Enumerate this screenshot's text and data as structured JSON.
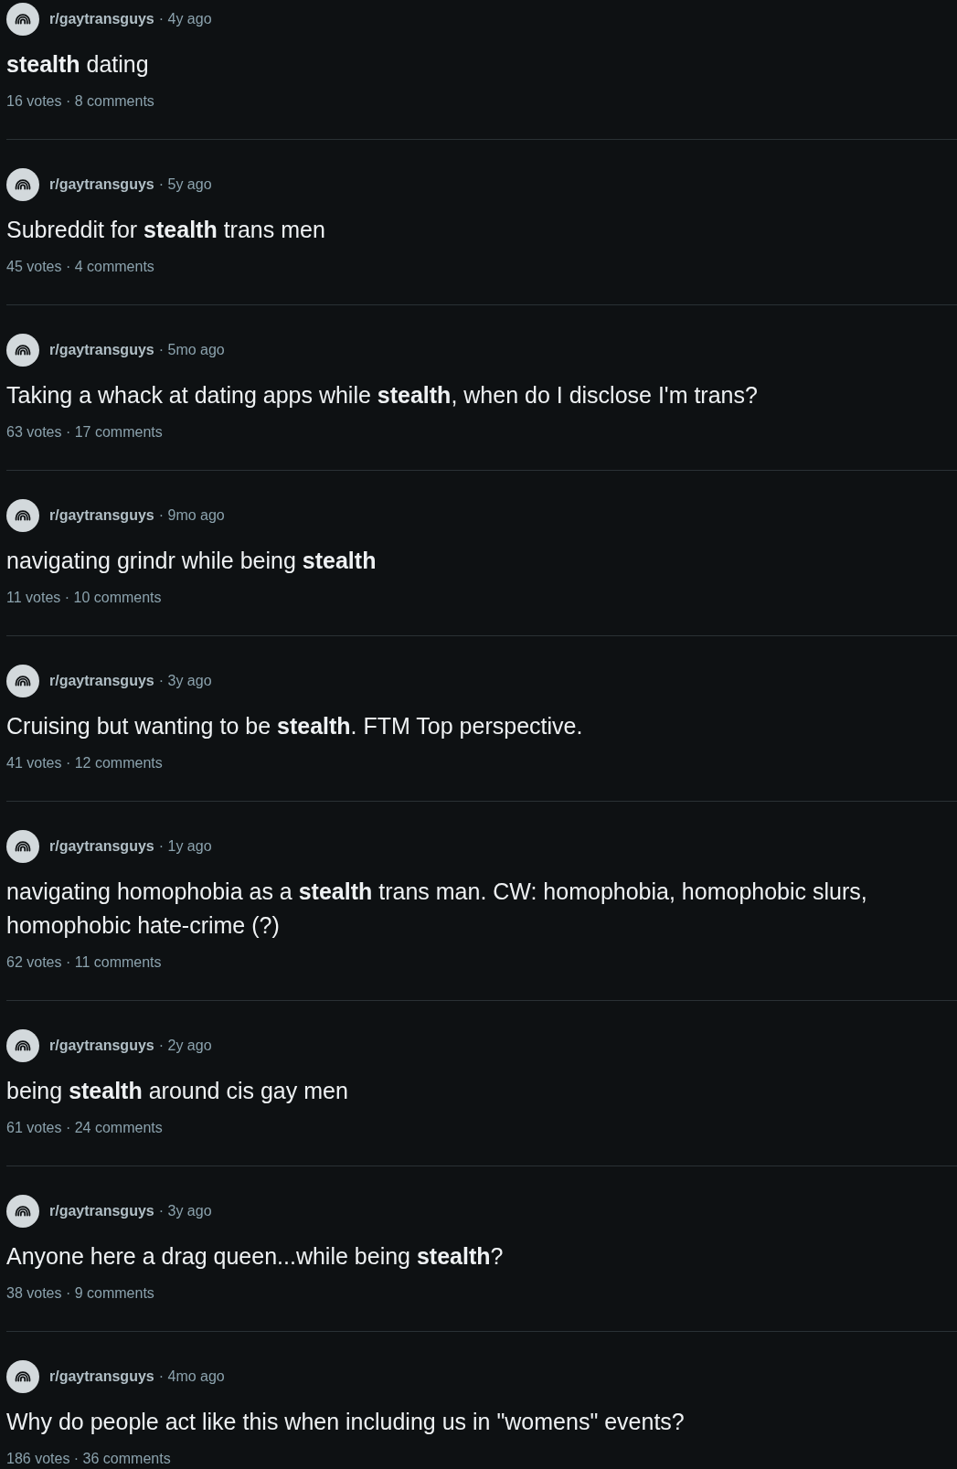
{
  "results": [
    {
      "subreddit": "r/gaytransguys",
      "age": "· 4y ago",
      "title": "**stealth** dating",
      "stats": "16 votes · 8 comments"
    },
    {
      "subreddit": "r/gaytransguys",
      "age": "· 5y ago",
      "title": "Subreddit for **stealth** trans men",
      "stats": "45 votes · 4 comments"
    },
    {
      "subreddit": "r/gaytransguys",
      "age": "· 5mo ago",
      "title": "Taking a whack at dating apps while **stealth**, when do I disclose I'm trans?",
      "stats": "63 votes · 17 comments"
    },
    {
      "subreddit": "r/gaytransguys",
      "age": "· 9mo ago",
      "title": "navigating grindr while being **stealth**",
      "stats": "11 votes · 10 comments"
    },
    {
      "subreddit": "r/gaytransguys",
      "age": "· 3y ago",
      "title": "Cruising but wanting to be **stealth**. FTM Top perspective.",
      "stats": "41 votes · 12 comments"
    },
    {
      "subreddit": "r/gaytransguys",
      "age": "· 1y ago",
      "title": "navigating homophobia as a **stealth** trans man. CW: homophobia, homophobic slurs, homophobic hate-crime (?)",
      "stats": "62 votes · 11 comments"
    },
    {
      "subreddit": "r/gaytransguys",
      "age": "· 2y ago",
      "title": "being **stealth** around cis gay men",
      "stats": "61 votes · 24 comments"
    },
    {
      "subreddit": "r/gaytransguys",
      "age": "· 3y ago",
      "title": "Anyone here a drag queen...while being **stealth**?",
      "stats": "38 votes · 9 comments"
    },
    {
      "subreddit": "r/gaytransguys",
      "age": "· 4mo ago",
      "title": "Why do people act like this when including us in \"womens\" events?",
      "stats": "186 votes · 36 comments"
    }
  ]
}
